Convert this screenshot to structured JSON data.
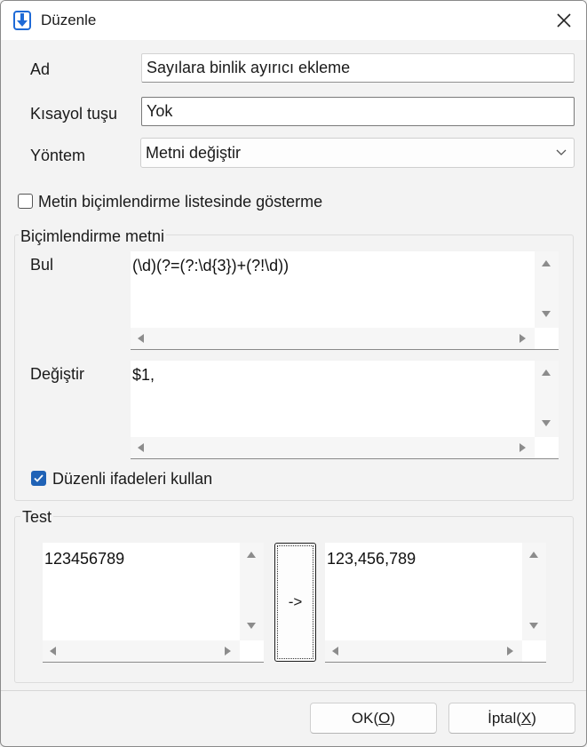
{
  "window": {
    "title": "Düzenle"
  },
  "form": {
    "name_label": "Ad",
    "name_value": "Sayılara binlik ayırıcı ekleme",
    "shortcut_label": "Kısayol tuşu",
    "shortcut_value": "Yok",
    "method_label": "Yöntem",
    "method_value": "Metni değiştir",
    "hide_checkbox_label": "Metin biçimlendirme listesinde gösterme",
    "hide_checkbox_checked": false
  },
  "format_group": {
    "title": "Biçimlendirme metni",
    "find_label": "Bul",
    "find_value": "(\\d)(?=(?:\\d{3})+(?!\\d))",
    "replace_label": "Değiştir",
    "replace_value": "$1,",
    "regex_label": "Düzenli ifadeleri kullan",
    "regex_checked": true
  },
  "test_group": {
    "title": "Test",
    "input_value": "123456789",
    "run_label": "->",
    "output_value": "123,456,789"
  },
  "buttons": {
    "ok_prefix": "OK(",
    "ok_key": "O",
    "ok_suffix": ")",
    "cancel_prefix": "İptal(",
    "cancel_key": "X",
    "cancel_suffix": ")"
  },
  "colors": {
    "accent": "#1f62b6",
    "title_icon": "#1e6ad6"
  },
  "icons": {
    "app": "download-arrow-icon",
    "close": "close-icon",
    "dropdown": "chevron-down-icon",
    "check": "checkmark-icon"
  }
}
